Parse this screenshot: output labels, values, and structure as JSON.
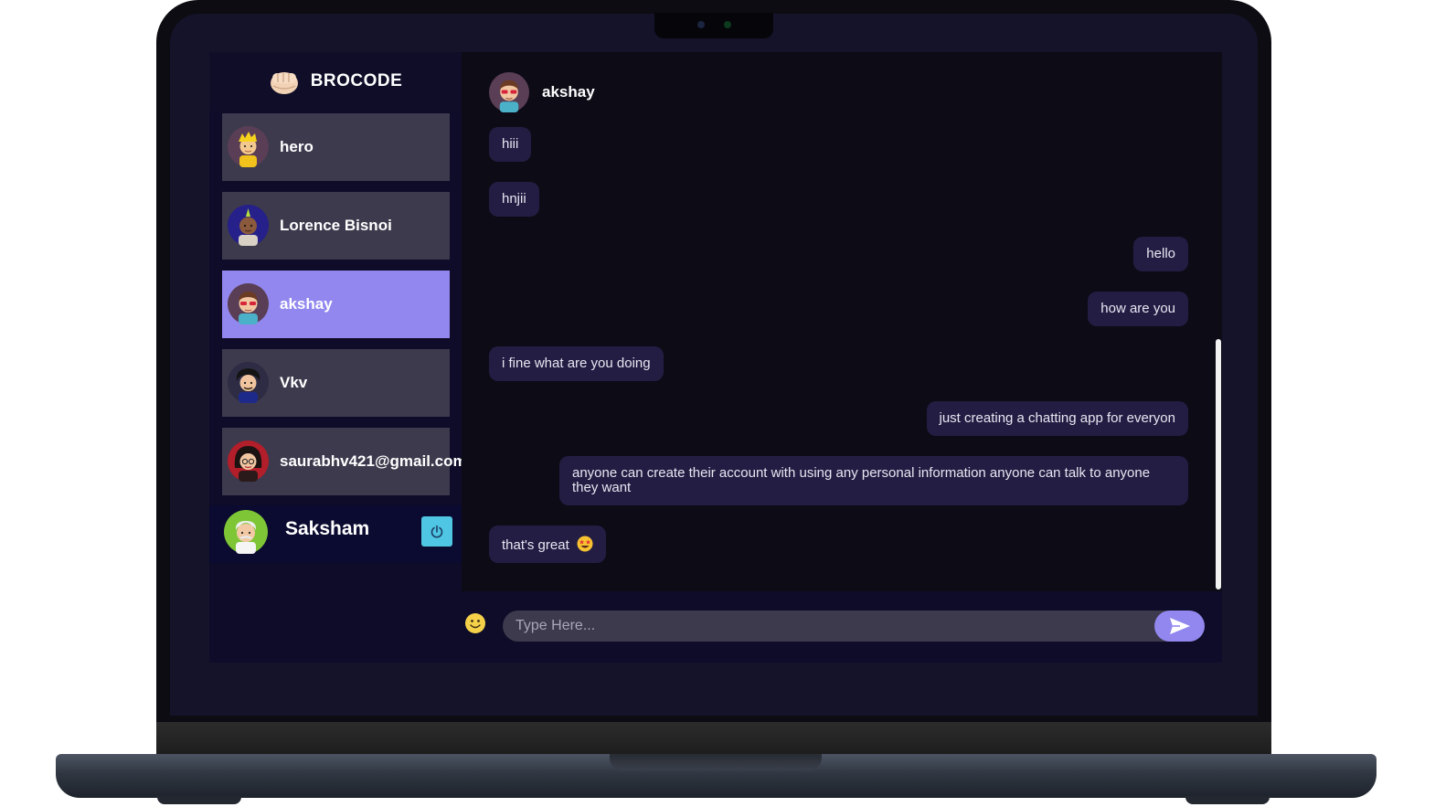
{
  "app": {
    "brand_name": "BROCODE",
    "brand_icon": "fist-icon"
  },
  "sidebar": {
    "contacts": [
      {
        "name": "hero",
        "avatar": "blond-boy-avatar",
        "active": false
      },
      {
        "name": "Lorence Bisnoi",
        "avatar": "mohawk-man-avatar",
        "active": false
      },
      {
        "name": "akshay",
        "avatar": "sunglasses-man-avatar",
        "active": true
      },
      {
        "name": "Vkv",
        "avatar": "curly-hair-man-avatar",
        "active": false
      },
      {
        "name": "saurabhv421@gmail.com",
        "avatar": "glasses-woman-avatar",
        "active": false
      }
    ],
    "current_user": {
      "name": "Saksham",
      "avatar": "old-man-avatar",
      "logout_icon": "power-icon"
    }
  },
  "chat": {
    "header_name": "akshay",
    "messages": [
      {
        "text": "hiii",
        "direction": "received"
      },
      {
        "text": "hnjii",
        "direction": "received"
      },
      {
        "text": "hello",
        "direction": "sent"
      },
      {
        "text": "how are you",
        "direction": "sent"
      },
      {
        "text": "i fine what are you doing",
        "direction": "received"
      },
      {
        "text": "just creating a chatting app for everyon",
        "direction": "sent"
      },
      {
        "text": "anyone can create their account with using any personal information anyone can talk to anyone they want",
        "direction": "sent"
      },
      {
        "text": "that's great",
        "direction": "received",
        "emoji": "star-struck-emoji"
      }
    ]
  },
  "input": {
    "placeholder": "Type Here...",
    "value": "",
    "emoji_icon": "smiley-icon",
    "send_icon": "send-icon"
  },
  "colors": {
    "accent": "#9187ee",
    "contact_bg": "#3d3a4d",
    "bubble_bg": "#241d43",
    "sidebar_bg": "#0e0c28",
    "chat_bg": "#0d0b16",
    "logout_bg": "#4fc6e4"
  }
}
